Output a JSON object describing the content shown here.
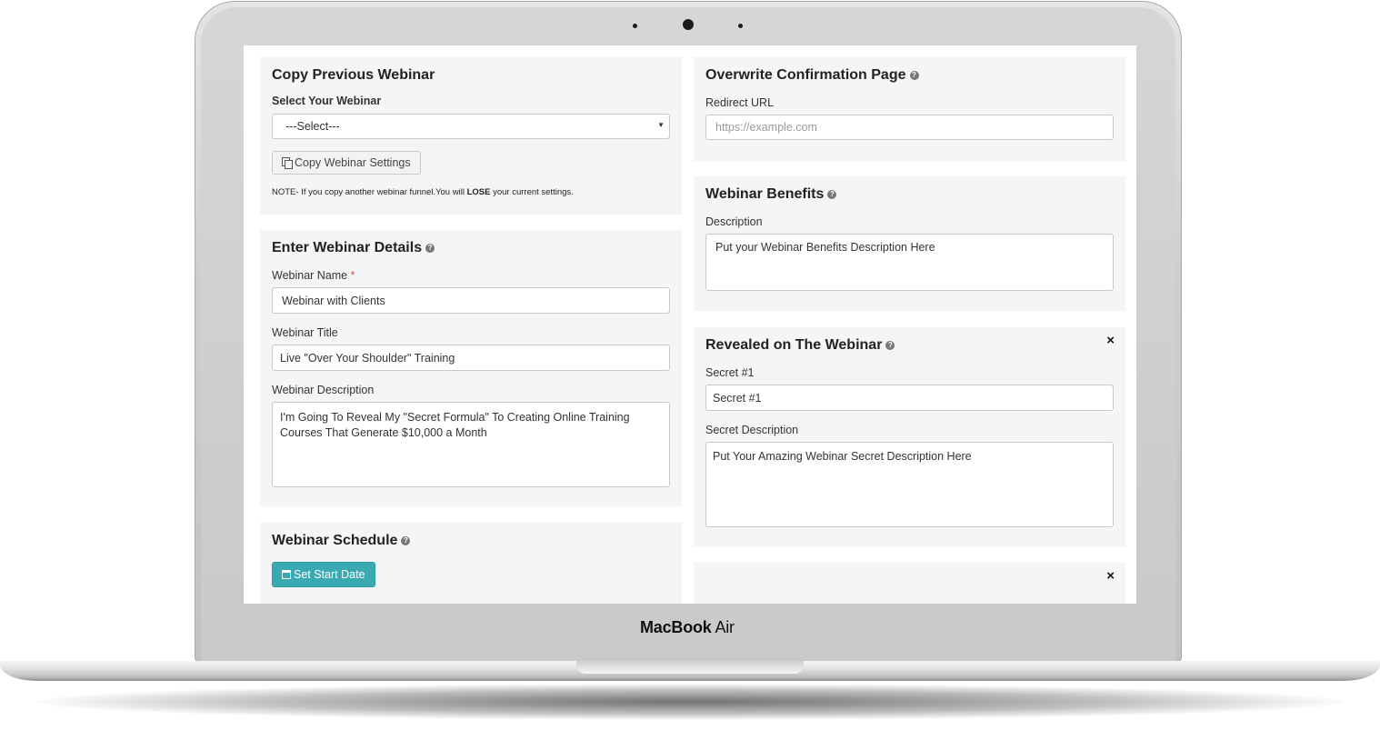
{
  "device": {
    "brand_bold": "MacBook",
    "brand_light": "Air"
  },
  "copy_panel": {
    "title": "Copy Previous Webinar",
    "select_label": "Select Your Webinar",
    "select_value": "---Select---",
    "copy_button": "Copy Webinar Settings",
    "note_prefix": "NOTE- If you copy another webinar funnel.You will ",
    "note_bold": "LOSE",
    "note_suffix": " your current settings."
  },
  "details_panel": {
    "title": "Enter Webinar Details",
    "name_label": "Webinar Name",
    "required_mark": "*",
    "name_value": "Webinar with Clients",
    "title_label": "Webinar Title",
    "title_value": "Live \"Over Your Shoulder\" Training",
    "description_label": "Webinar Description",
    "description_value": "I'm Going To Reveal My \"Secret Formula\" To Creating Online Training Courses That Generate $10,000 a Month"
  },
  "schedule_panel": {
    "title": "Webinar Schedule",
    "button": "Set Start Date"
  },
  "confirmation_panel": {
    "title": "Overwrite Confirmation Page",
    "url_label": "Redirect URL",
    "url_placeholder": "https://example.com"
  },
  "benefits_panel": {
    "title": "Webinar Benefits",
    "description_label": "Description",
    "description_value": "Put your Webinar Benefits Description Here"
  },
  "revealed_panel": {
    "title": "Revealed on The Webinar",
    "secret_label": "Secret #1",
    "secret_value": "Secret #1",
    "secret_desc_label": "Secret Description",
    "secret_desc_value": "Put Your Amazing Webinar Secret Description Here",
    "close": "×"
  },
  "next_panel": {
    "close": "×"
  },
  "icons": {
    "help": "?",
    "caret": "▼"
  }
}
